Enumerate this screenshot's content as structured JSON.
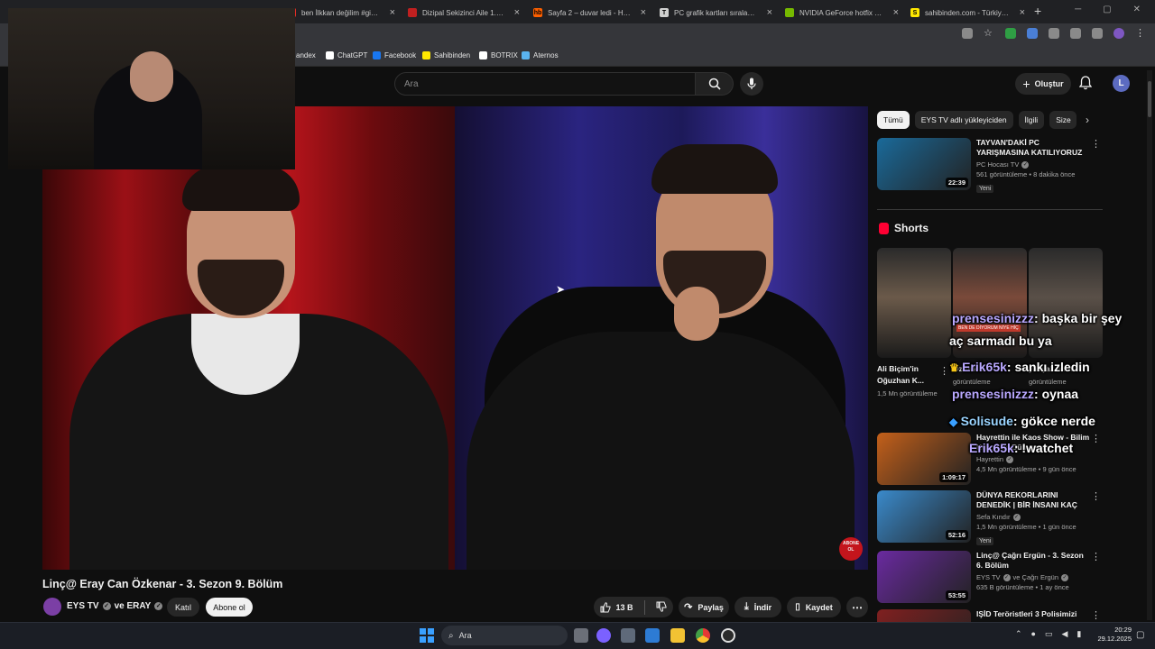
{
  "browser": {
    "tabs": [
      {
        "title": "ben İlkkan değilim #gibi #er",
        "favicon_color": "#e52d27",
        "favicon_glyph": ""
      },
      {
        "title": "Dizipal Sekizinci Aile 1.Sezon",
        "favicon_color": "#c02020",
        "favicon_glyph": ""
      },
      {
        "title": "Sayfa 2 – duvar ledi - Hepsib",
        "favicon_color": "#ff6000",
        "favicon_glyph": "hb"
      },
      {
        "title": "PC grafik kartları sıralaması",
        "favicon_color": "#d0d0d0",
        "favicon_glyph": "T"
      },
      {
        "title": "NVIDIA GeForce hotfix sürü",
        "favicon_color": "#76b900",
        "favicon_glyph": ""
      },
      {
        "title": "sahibinden.com - Türkiye'nin",
        "favicon_color": "#ffe800",
        "favicon_glyph": "S"
      }
    ],
    "new_tab": "+",
    "bookmarks": [
      {
        "label": "andex",
        "color": "#e33"
      },
      {
        "label": "ChatGPT",
        "color": "#ffffff"
      },
      {
        "label": "Facebook",
        "color": "#1877f2"
      },
      {
        "label": "Sahibinden",
        "color": "#ffe800"
      },
      {
        "label": "BOTRIX",
        "color": "#ffffff"
      },
      {
        "label": "Aternos",
        "color": "#5ab4f0"
      }
    ]
  },
  "youtube": {
    "search_placeholder": "Ara",
    "create_label": "Oluştur",
    "avatar_letter": "L",
    "video": {
      "title": "Linç@ Eray Can Özkenar - 3. Sezon 9. Bölüm",
      "channel": "EYS TV",
      "collab": "ve ERAY",
      "join_label": "Katıl",
      "subscribe_label": "Abone ol",
      "likes": "13 B",
      "share_label": "Paylaş",
      "download_label": "İndir",
      "save_label": "Kaydet",
      "overlay_badge": "ABONE OL"
    },
    "chips": [
      "Tümü",
      "EYS TV adlı yükleyiciden",
      "İlgili",
      "Size"
    ],
    "related": [
      {
        "title": "TAYVAN'DAKİ PC YARIŞMASINA KATILIYORUZ -...",
        "channel": "PC Hocası TV",
        "stats": "561 görüntüleme • 8 dakika önce",
        "duration": "22:39",
        "badge": "Yeni",
        "thumb": "#1a6a9a"
      },
      {
        "title": "Hayrettin ile Kaos Show - Bilim Kurgu ve Dünyamız",
        "channel": "Hayrettin",
        "stats": "4,5 Mn görüntüleme • 9 gün önce",
        "duration": "1:09:17",
        "badge": "",
        "thumb": "#c4601a"
      },
      {
        "title": "DÜNYA REKORLARINI DENEDİK | BİR İNSANI KAÇ BALON ...",
        "channel": "Sefa Kındır",
        "stats": "1,5 Mn görüntüleme • 1 gün önce",
        "duration": "52:16",
        "badge": "Yeni",
        "thumb": "#3a8acb"
      },
      {
        "title": "Linç@ Çağrı Ergün - 3. Sezon 6. Bölüm",
        "channel": "EYS TV",
        "collab": "ve Çağrı Ergün",
        "stats": "635 B görüntüleme • 1 ay önce",
        "duration": "53:55",
        "badge": "",
        "thumb": "#6a2aa0"
      },
      {
        "title": "IŞİD Teröristleri 3 Polisimizi",
        "channel": "",
        "stats": "",
        "duration": "",
        "badge": "",
        "thumb": "#802020"
      }
    ],
    "shorts_header": "Shorts",
    "shorts": [
      {
        "title": "Ali Biçim'in Oğuzhan K...",
        "views": "1,5 Mn görüntüleme",
        "thumb": "#6b5a4a"
      },
      {
        "title": "Öztürk ...",
        "views": "görüntüleme",
        "thumb": "#7a4a3a"
      },
      {
        "title": "yavşak bir ...",
        "views": "görüntüleme",
        "thumb": "#5a5048"
      }
    ],
    "short_caption": "BEN DE DİYORUM NİYE HİÇ"
  },
  "chat_overlay": [
    {
      "user": "prensesinizzz",
      "message": ": başka bir şey"
    },
    {
      "user": "",
      "message": "aç sarmadı bu ya"
    },
    {
      "user": "Erik65k",
      "message": ": sankı izledin"
    },
    {
      "user": "prensesinizzz",
      "message": ": oynaa"
    },
    {
      "user": "Solisude",
      "message": ": gökce nerde"
    },
    {
      "user": "Erik65k",
      "message": ": !watchet"
    }
  ],
  "taskbar": {
    "search_label": "Ara",
    "time": "20:29",
    "date": "29.12.2025"
  }
}
